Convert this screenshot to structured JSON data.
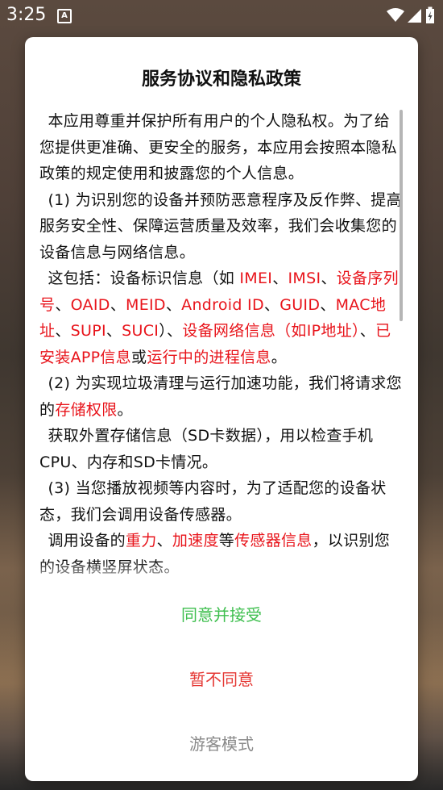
{
  "status_bar": {
    "time": "3:25",
    "notification_icon": "A"
  },
  "dialog": {
    "title": "服务协议和隐私政策",
    "paragraphs": [
      [
        {
          "t": "本应用尊重并保护所有用户的个人隐私权。为了给您提供更准确、更安全的服务，本应用会按照本隐私政策的规定使用和披露您的个人信息。"
        }
      ],
      [
        {
          "t": "(1) 为识别您的设备并预防恶意程序及反作弊、提高服务安全性、保障运营质量及效率，我们会收集您的设备信息与网络信息。"
        }
      ],
      [
        {
          "t": "这包括：设备标识信息（如 "
        },
        {
          "t": "IMEI",
          "hl": true
        },
        {
          "t": "、"
        },
        {
          "t": "IMSI",
          "hl": true
        },
        {
          "t": "、"
        },
        {
          "t": "设备序列号",
          "hl": true
        },
        {
          "t": "、"
        },
        {
          "t": "OAID",
          "hl": true
        },
        {
          "t": "、"
        },
        {
          "t": "MEID",
          "hl": true
        },
        {
          "t": "、"
        },
        {
          "t": "Android ID",
          "hl": true
        },
        {
          "t": "、"
        },
        {
          "t": "GUID",
          "hl": true
        },
        {
          "t": "、"
        },
        {
          "t": "MAC地址",
          "hl": true
        },
        {
          "t": "、"
        },
        {
          "t": "SUPI",
          "hl": true
        },
        {
          "t": "、"
        },
        {
          "t": "SUCI",
          "hl": true
        },
        {
          "t": "）、"
        },
        {
          "t": "设备网络信息（如IP地址）",
          "hl": true
        },
        {
          "t": "、"
        },
        {
          "t": "已安装APP信息",
          "hl": true
        },
        {
          "t": "或"
        },
        {
          "t": "运行中的进程信息",
          "hl": true
        },
        {
          "t": "。"
        }
      ],
      [
        {
          "t": "(2) 为实现垃圾清理与运行加速功能，我们将请求您的"
        },
        {
          "t": "存储权限",
          "hl": true
        },
        {
          "t": "。"
        }
      ],
      [
        {
          "t": "获取外置存储信息（SD卡数据），用以检查手机CPU、内存和SD卡情况。"
        }
      ],
      [
        {
          "t": "(3) 当您播放视频等内容时，为了适配您的设备状态，我们会调用设备传感器。"
        }
      ],
      [
        {
          "t": "调用设备的"
        },
        {
          "t": "重力",
          "hl": true
        },
        {
          "t": "、"
        },
        {
          "t": "加速度",
          "hl": true
        },
        {
          "t": "等"
        },
        {
          "t": "传感器信息",
          "hl": true
        },
        {
          "t": "，以识别您的设备横竖屏状态。"
        }
      ]
    ],
    "buttons": {
      "accept": "同意并接受",
      "reject": "暂不同意",
      "guest": "游客模式"
    }
  },
  "colors": {
    "accept": "#3fbf4f",
    "reject": "#e53935",
    "guest": "#8a8a8a",
    "highlight": "#e8141b"
  }
}
